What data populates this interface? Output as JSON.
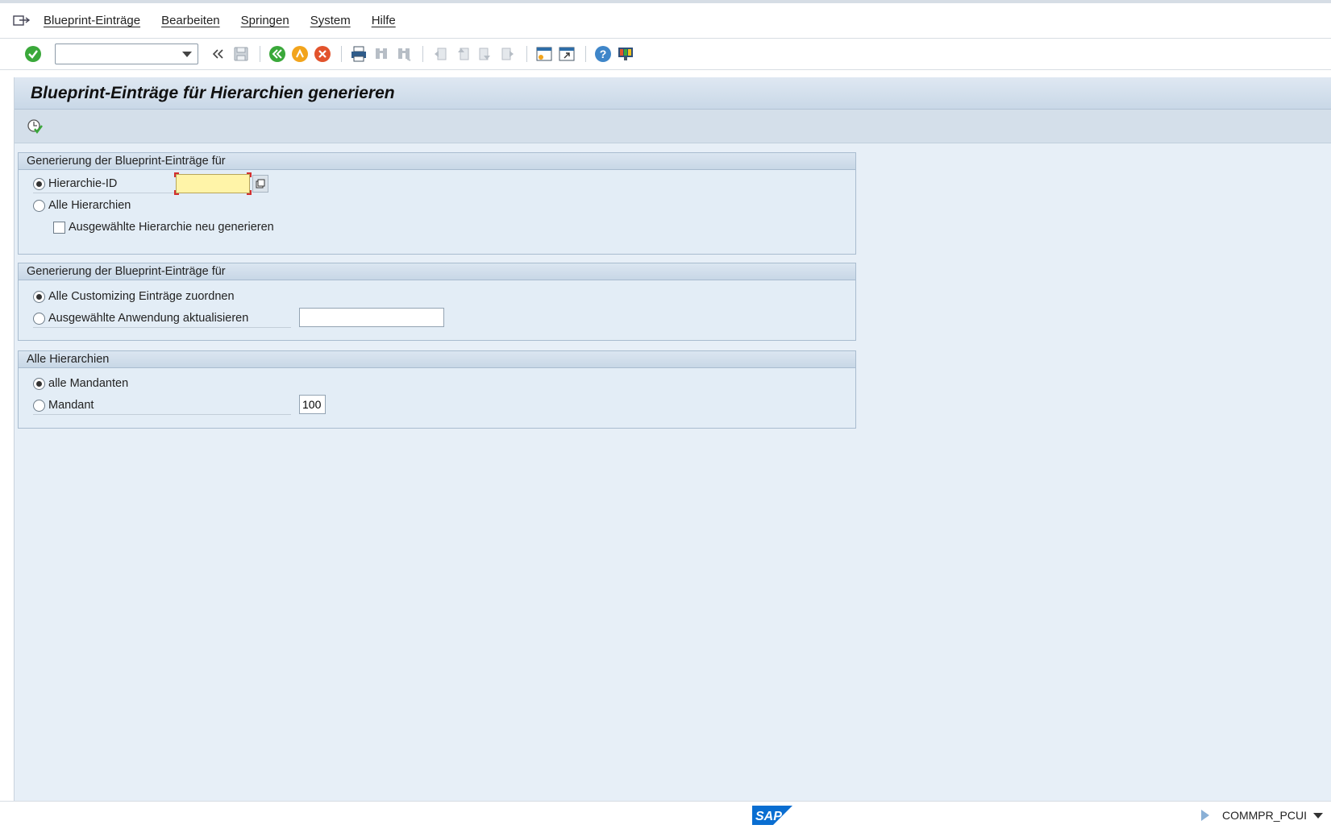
{
  "menubar": {
    "items": [
      "Blueprint-Einträge",
      "Bearbeiten",
      "Springen",
      "System",
      "Hilfe"
    ]
  },
  "toolbar": {
    "command_field_value": "",
    "icons": [
      "enter-icon",
      "back-double-icon",
      "save-icon",
      "back-icon",
      "exit-icon",
      "cancel-icon",
      "print-icon",
      "find-icon",
      "find-next-icon",
      "first-page-icon",
      "previous-page-icon",
      "next-page-icon",
      "last-page-icon",
      "new-session-icon",
      "shortcut-icon",
      "help-icon",
      "customize-layout-icon"
    ]
  },
  "screen": {
    "title": "Blueprint-Einträge für Hierarchien generieren",
    "execute_icon": "execute-icon"
  },
  "groups": [
    {
      "header": "Generierung der Blueprint-Einträge für",
      "rows": [
        {
          "type": "radio",
          "label": "Hierarchie-ID",
          "selected": true,
          "input_value": ""
        },
        {
          "type": "radio",
          "label": "Alle Hierarchien",
          "selected": false
        },
        {
          "type": "checkbox",
          "label": "Ausgewählte Hierarchie neu generieren",
          "checked": false
        }
      ]
    },
    {
      "header": "Generierung der Blueprint-Einträge für",
      "rows": [
        {
          "type": "radio",
          "label": "Alle Customizing Einträge zuordnen",
          "selected": true
        },
        {
          "type": "radio",
          "label": "Ausgewählte Anwendung aktualisieren",
          "selected": false,
          "input_value": ""
        }
      ]
    },
    {
      "header": "Alle Hierarchien",
      "rows": [
        {
          "type": "radio",
          "label": "alle Mandanten",
          "selected": true
        },
        {
          "type": "radio",
          "label": "Mandant",
          "selected": false,
          "input_value": "100"
        }
      ]
    }
  ],
  "statusbar": {
    "logo": "SAP",
    "system": "COMMPR_PCUI"
  },
  "colors": {
    "accent": "#0a6ed1",
    "background": "#e7eff7",
    "focus_input": "#fff4a8"
  }
}
